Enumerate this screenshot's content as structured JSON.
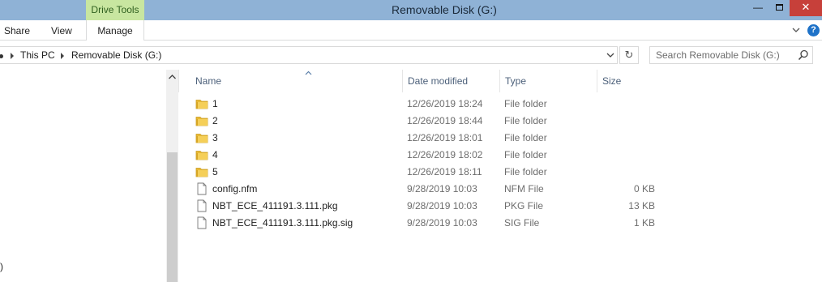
{
  "window": {
    "title": "Removable Disk (G:)",
    "context_tab": "Drive Tools",
    "min_glyph": "—",
    "close_glyph": "✕",
    "help_glyph": "?"
  },
  "ribbon": {
    "tabs": [
      {
        "label": "Share"
      },
      {
        "label": "View"
      },
      {
        "label": "Manage"
      }
    ]
  },
  "address": {
    "crumbs": [
      "This PC",
      "Removable Disk (G:)"
    ],
    "refresh_glyph": "↻"
  },
  "search": {
    "placeholder": "Search Removable Disk (G:)"
  },
  "nav": {
    "fragment": ")"
  },
  "columns": {
    "name": "Name",
    "date": "Date modified",
    "type": "Type",
    "size": "Size",
    "sorted_by": "Name",
    "sort_direction": "ascending"
  },
  "files": [
    {
      "name": "1",
      "date": "12/26/2019 18:24",
      "type": "File folder",
      "size": "",
      "icon": "folder-icon"
    },
    {
      "name": "2",
      "date": "12/26/2019 18:44",
      "type": "File folder",
      "size": "",
      "icon": "folder-icon"
    },
    {
      "name": "3",
      "date": "12/26/2019 18:01",
      "type": "File folder",
      "size": "",
      "icon": "folder-icon"
    },
    {
      "name": "4",
      "date": "12/26/2019 18:02",
      "type": "File folder",
      "size": "",
      "icon": "folder-icon"
    },
    {
      "name": "5",
      "date": "12/26/2019 18:11",
      "type": "File folder",
      "size": "",
      "icon": "folder-icon"
    },
    {
      "name": "config.nfm",
      "date": "9/28/2019 10:03",
      "type": "NFM File",
      "size": "0 KB",
      "icon": "file-icon"
    },
    {
      "name": "NBT_ECE_411191.3.111.pkg",
      "date": "9/28/2019 10:03",
      "type": "PKG File",
      "size": "13 KB",
      "icon": "file-icon"
    },
    {
      "name": "NBT_ECE_411191.3.111.pkg.sig",
      "date": "9/28/2019 10:03",
      "type": "SIG File",
      "size": "1 KB",
      "icon": "file-icon"
    }
  ],
  "colors": {
    "titlebar": "#8fb2d6",
    "context_tab": "#c8e6a0",
    "close_button": "#c7403a",
    "folder": "#e8b934",
    "help": "#1e72c8"
  }
}
